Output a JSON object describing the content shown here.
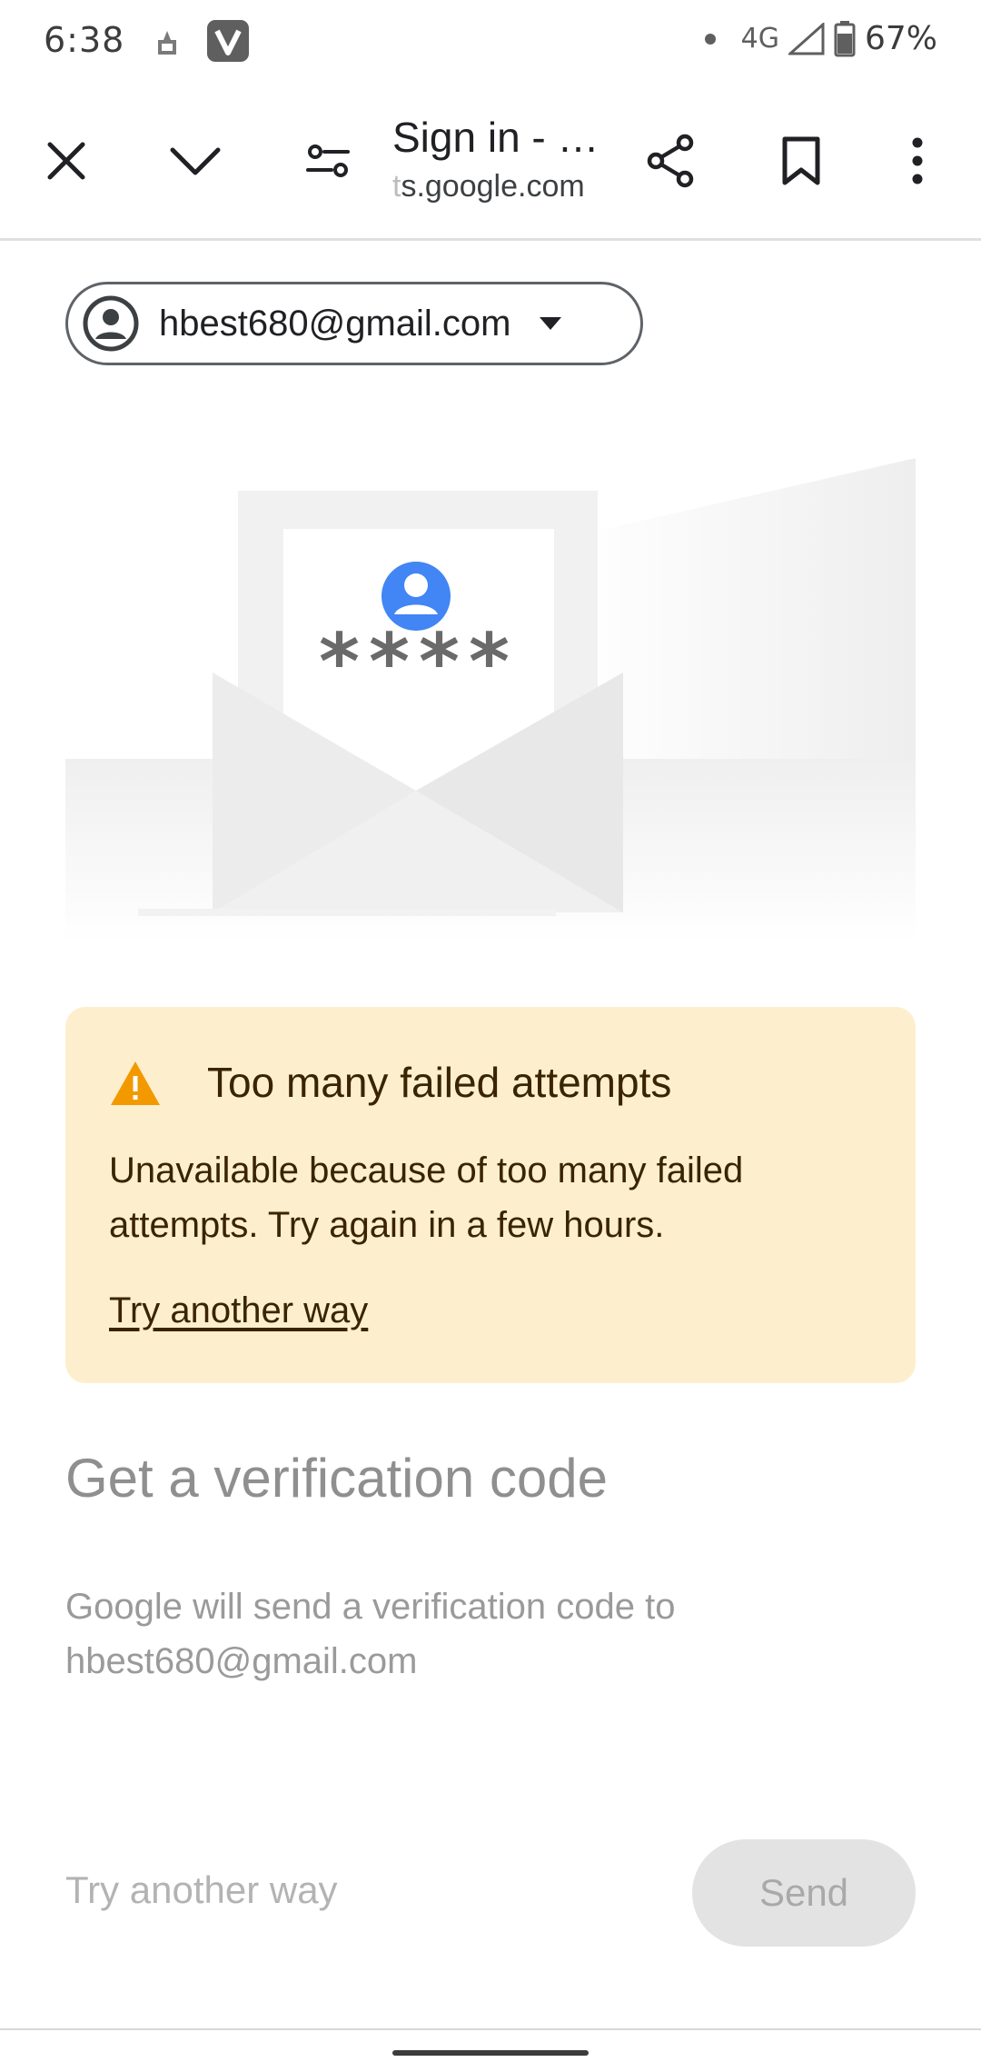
{
  "status_bar": {
    "time": "6:38",
    "network": "4G",
    "battery": "67%"
  },
  "toolbar": {
    "title": "Sign in - …",
    "url_faded": "t",
    "url_main": "s.google.com"
  },
  "account": {
    "email": "hbest680@gmail.com"
  },
  "illustration": {
    "password_mask": "****",
    "accent_color": "#4285f4"
  },
  "warning": {
    "title": "Too many failed attempts",
    "body": "Unavailable because of too many failed attempts. Try again in a few hours.",
    "link": "Try another way",
    "background": "#fdefce",
    "icon_color": "#f29900"
  },
  "verification": {
    "heading": "Get a verification code",
    "body_line1": "Google will send a verification code to",
    "body_line2": "hbest680@gmail.com"
  },
  "footer": {
    "try_another": "Try another way",
    "send": "Send"
  }
}
